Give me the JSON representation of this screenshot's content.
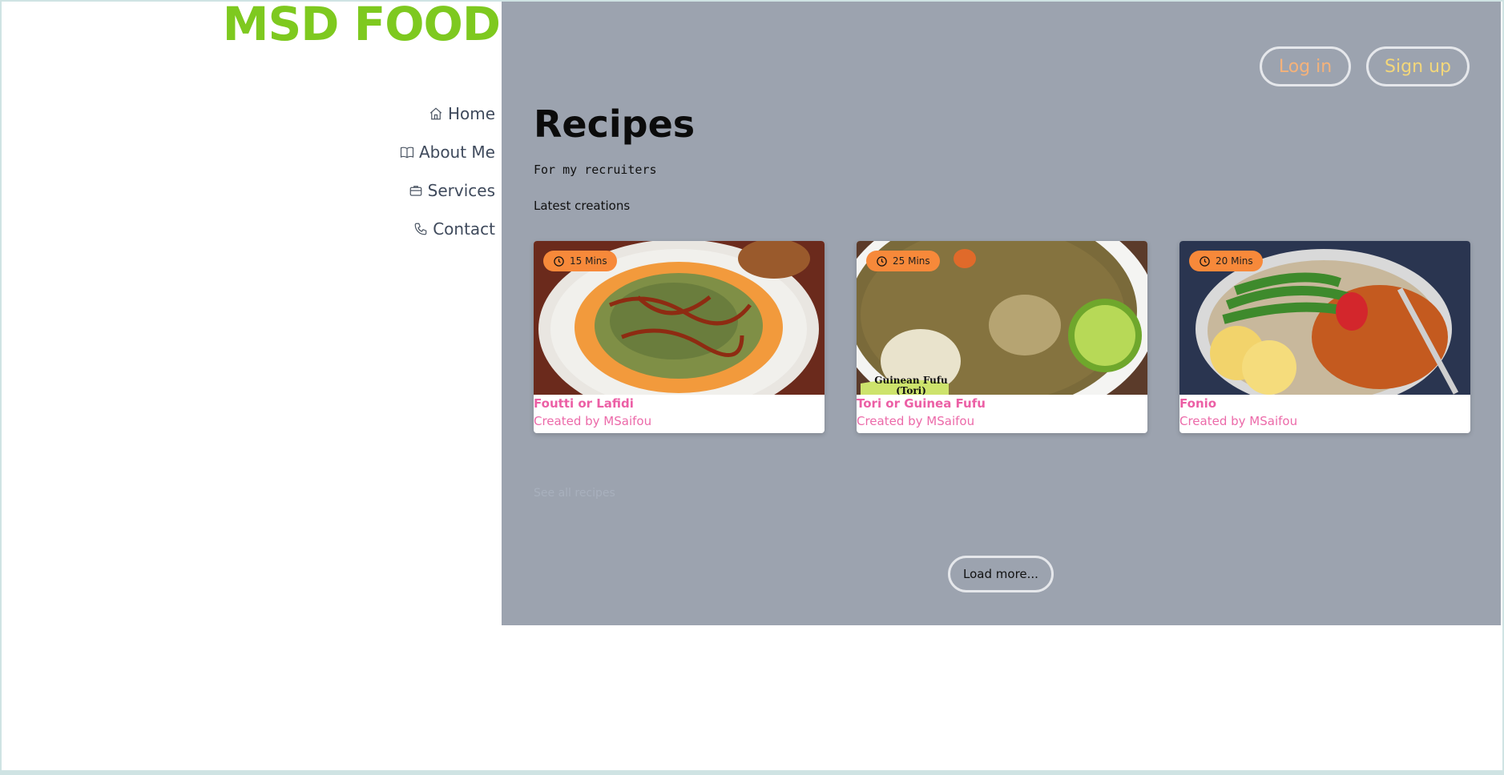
{
  "brand": "MSD FOOD",
  "nav": [
    {
      "label": "Home",
      "icon": "home-icon"
    },
    {
      "label": "About Me",
      "icon": "book-icon"
    },
    {
      "label": "Services",
      "icon": "briefcase-icon"
    },
    {
      "label": "Contact",
      "icon": "phone-icon"
    }
  ],
  "auth": {
    "login": "Log in",
    "signup": "Sign up"
  },
  "page": {
    "title": "Recipes",
    "subtitle": "For my recruiters",
    "section": "Latest creations",
    "faint_link": "See all recipes",
    "load_more": "Load more..."
  },
  "recipes": [
    {
      "time": "15 Mins",
      "title": "Foutti or Lafidi",
      "author": "Created by MSaifou"
    },
    {
      "time": "25 Mins",
      "title": "Tori or Guinea Fufu",
      "author": "Created by MSaifou",
      "image_caption": "Guinean Fufu (Tori)"
    },
    {
      "time": "20 Mins",
      "title": "Fonio",
      "author": "Created by MSaifou"
    }
  ],
  "colors": {
    "brand": "#7ec91f",
    "panel": "#9ca3af",
    "badge": "#f7893a",
    "recipe_text": "#ec5fa5",
    "login": "#f5b27a",
    "signup": "#f3d77a"
  }
}
